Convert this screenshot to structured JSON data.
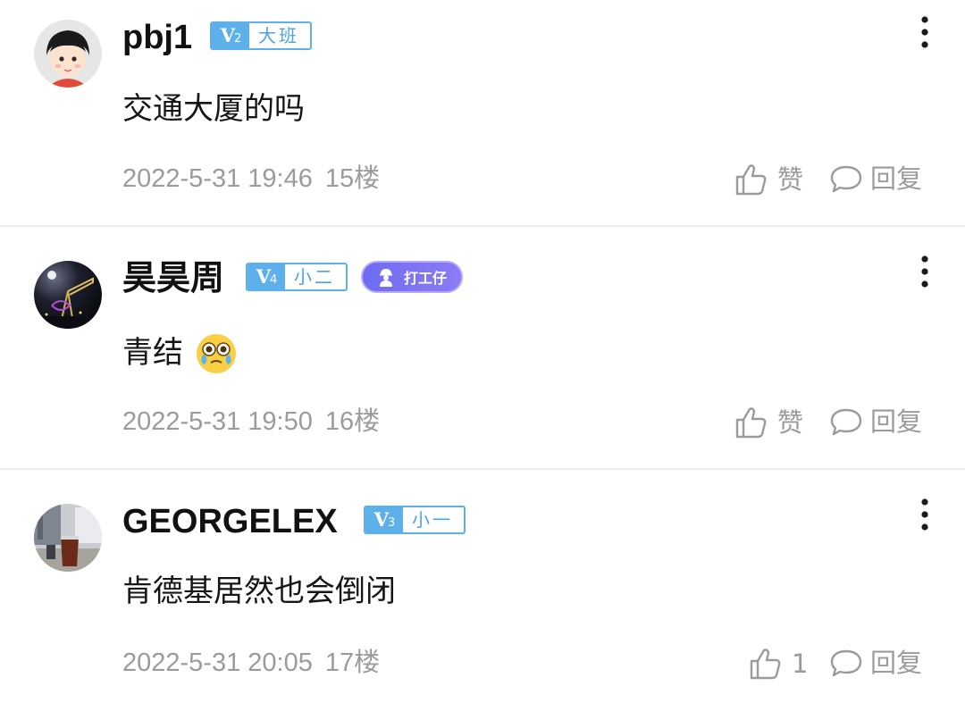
{
  "comments": [
    {
      "username": "pbj1",
      "level": "V",
      "level_num": "2",
      "rank": "大班",
      "title_badge": "",
      "text": "交通大厦的吗",
      "emoji": "",
      "date": "2022-5-31 19:46",
      "floor": "15楼",
      "like_label": "赞",
      "reply_label": "回复",
      "avatar_icon": "cartoon-boy-avatar"
    },
    {
      "username": "昊昊周",
      "level": "V",
      "level_num": "4",
      "rank": "小二",
      "title_badge": "打工仔",
      "text": "青结",
      "emoji": "crying-face-emoji",
      "date": "2022-5-31 19:50",
      "floor": "16楼",
      "like_label": "赞",
      "reply_label": "回复",
      "avatar_icon": "night-crane-avatar"
    },
    {
      "username": "GEORGELEX",
      "level": "V",
      "level_num": "3",
      "rank": "小一",
      "title_badge": "",
      "text": "肯德基居然也会倒闭",
      "emoji": "",
      "date": "2022-5-31 20:05",
      "floor": "17楼",
      "like_label": "1",
      "reply_label": "回复",
      "avatar_icon": "coffee-photo-avatar"
    }
  ],
  "colors": {
    "level_badge": "#5db0ea",
    "title_badge": "#6f6cf2",
    "meta_text": "#9b9b9b",
    "divider": "#ececec"
  }
}
